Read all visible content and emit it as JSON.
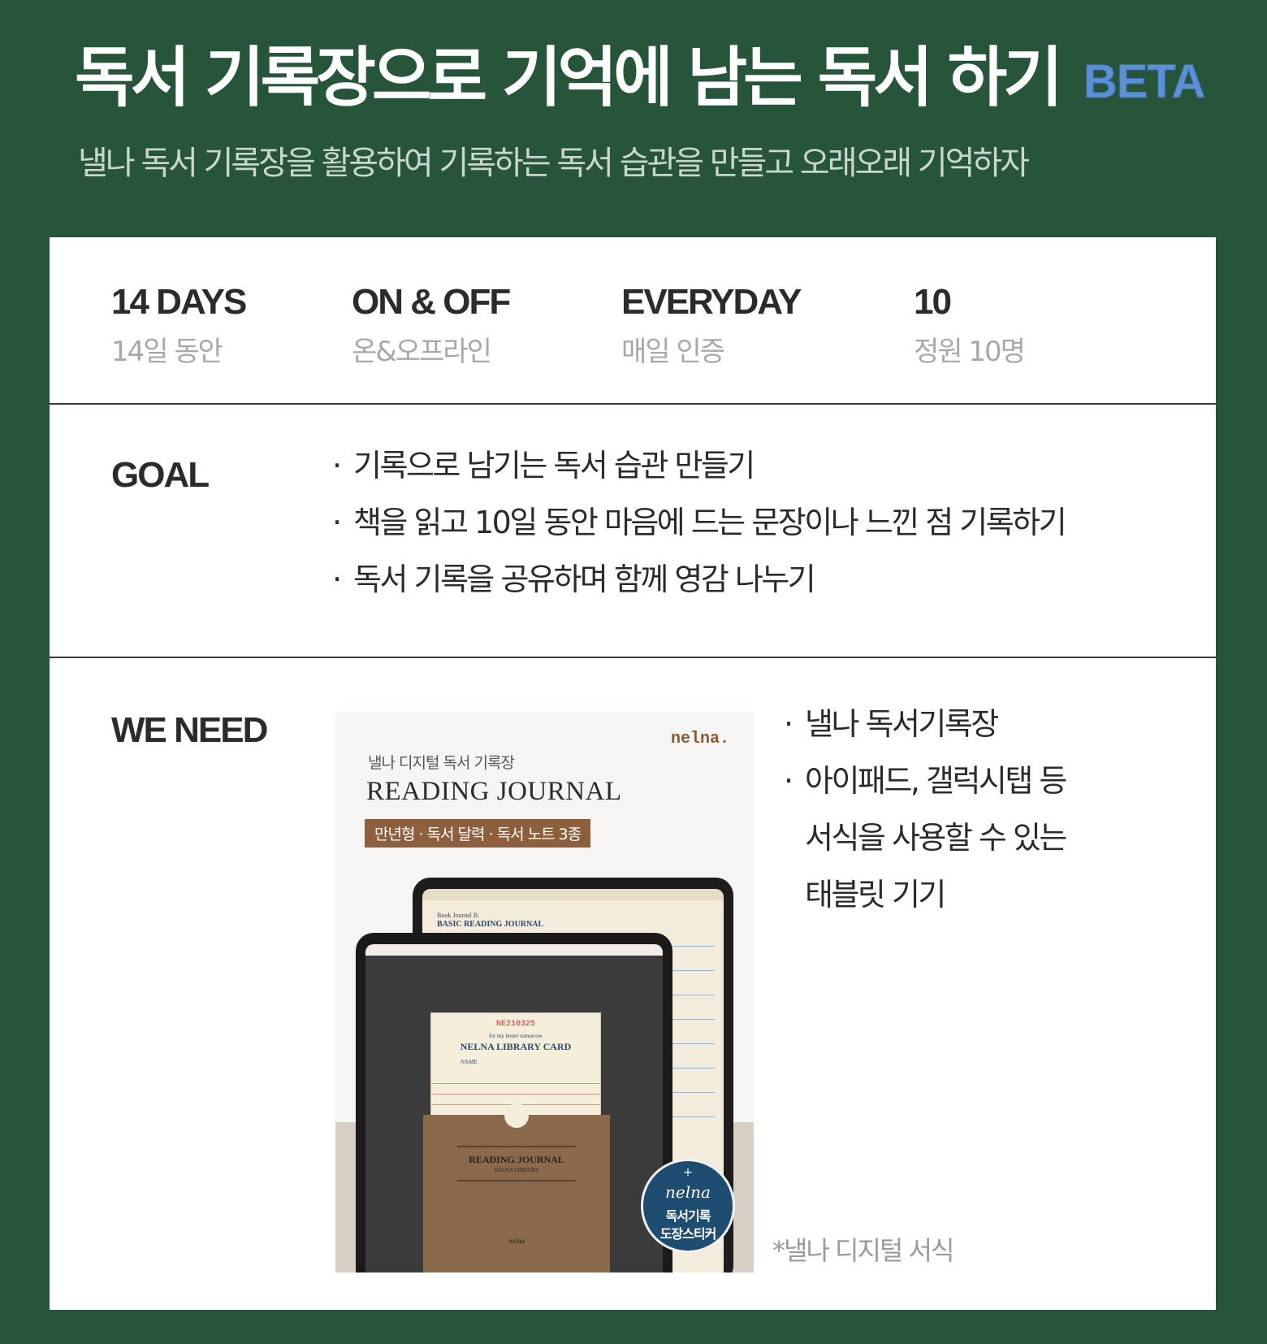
{
  "header": {
    "title": "독서 기록장으로 기억에 남는 독서 하기",
    "badge": "BETA",
    "subtitle": "낼나 독서 기록장을 활용하여 기록하는 독서 습관을 만들고 오래오래 기억하자"
  },
  "stats": [
    {
      "en": "14 DAYS",
      "ko": "14일 동안"
    },
    {
      "en": "ON & OFF",
      "ko": "온&오프라인"
    },
    {
      "en": "EVERYDAY",
      "ko": "매일 인증"
    },
    {
      "en": "10",
      "ko": "정원 10명"
    }
  ],
  "goal": {
    "label": "GOAL",
    "items": [
      "기록으로 남기는 독서 습관 만들기",
      "책을 읽고 10일 동안 마음에 드는 문장이나 느낀 점 기록하기",
      "독서 기록을 공유하며 함께 영감 나누기"
    ]
  },
  "need": {
    "label": "WE NEED",
    "items": [
      "낼나 독서기록장",
      "아이패드, 갤럭시탭 등",
      "서식을 사용할 수 있는",
      "태블릿 기기"
    ],
    "footnote": "*낼나 디지털 서식"
  },
  "product": {
    "brand": "nelna.",
    "subtitle": "낼나 디지털 독서 기록장",
    "title": "READING JOURNAL",
    "tag": "만년형 · 독서 달력 · 독서 노트 3종",
    "back_screen_heading1": "Book Journal B.",
    "back_screen_heading2": "BASIC READING JOURNAL",
    "card_number": "NE210325",
    "card_small": "for my better tomorrow",
    "card_title": "NELNA LIBRARY CARD",
    "card_name_label": "NAME",
    "pocket_title": "READING JOURNAL",
    "pocket_sub": "NELNA LIBRARY",
    "pocket_brand": "nelna",
    "stamp_plus": "+",
    "stamp_script": "nelna",
    "stamp_line1": "독서기록",
    "stamp_line2": "도장스티커"
  },
  "colors": {
    "background": "#27553a",
    "card": "#ffffff",
    "badge": "#5b8fd6",
    "muted_text": "#a8a8a8"
  }
}
